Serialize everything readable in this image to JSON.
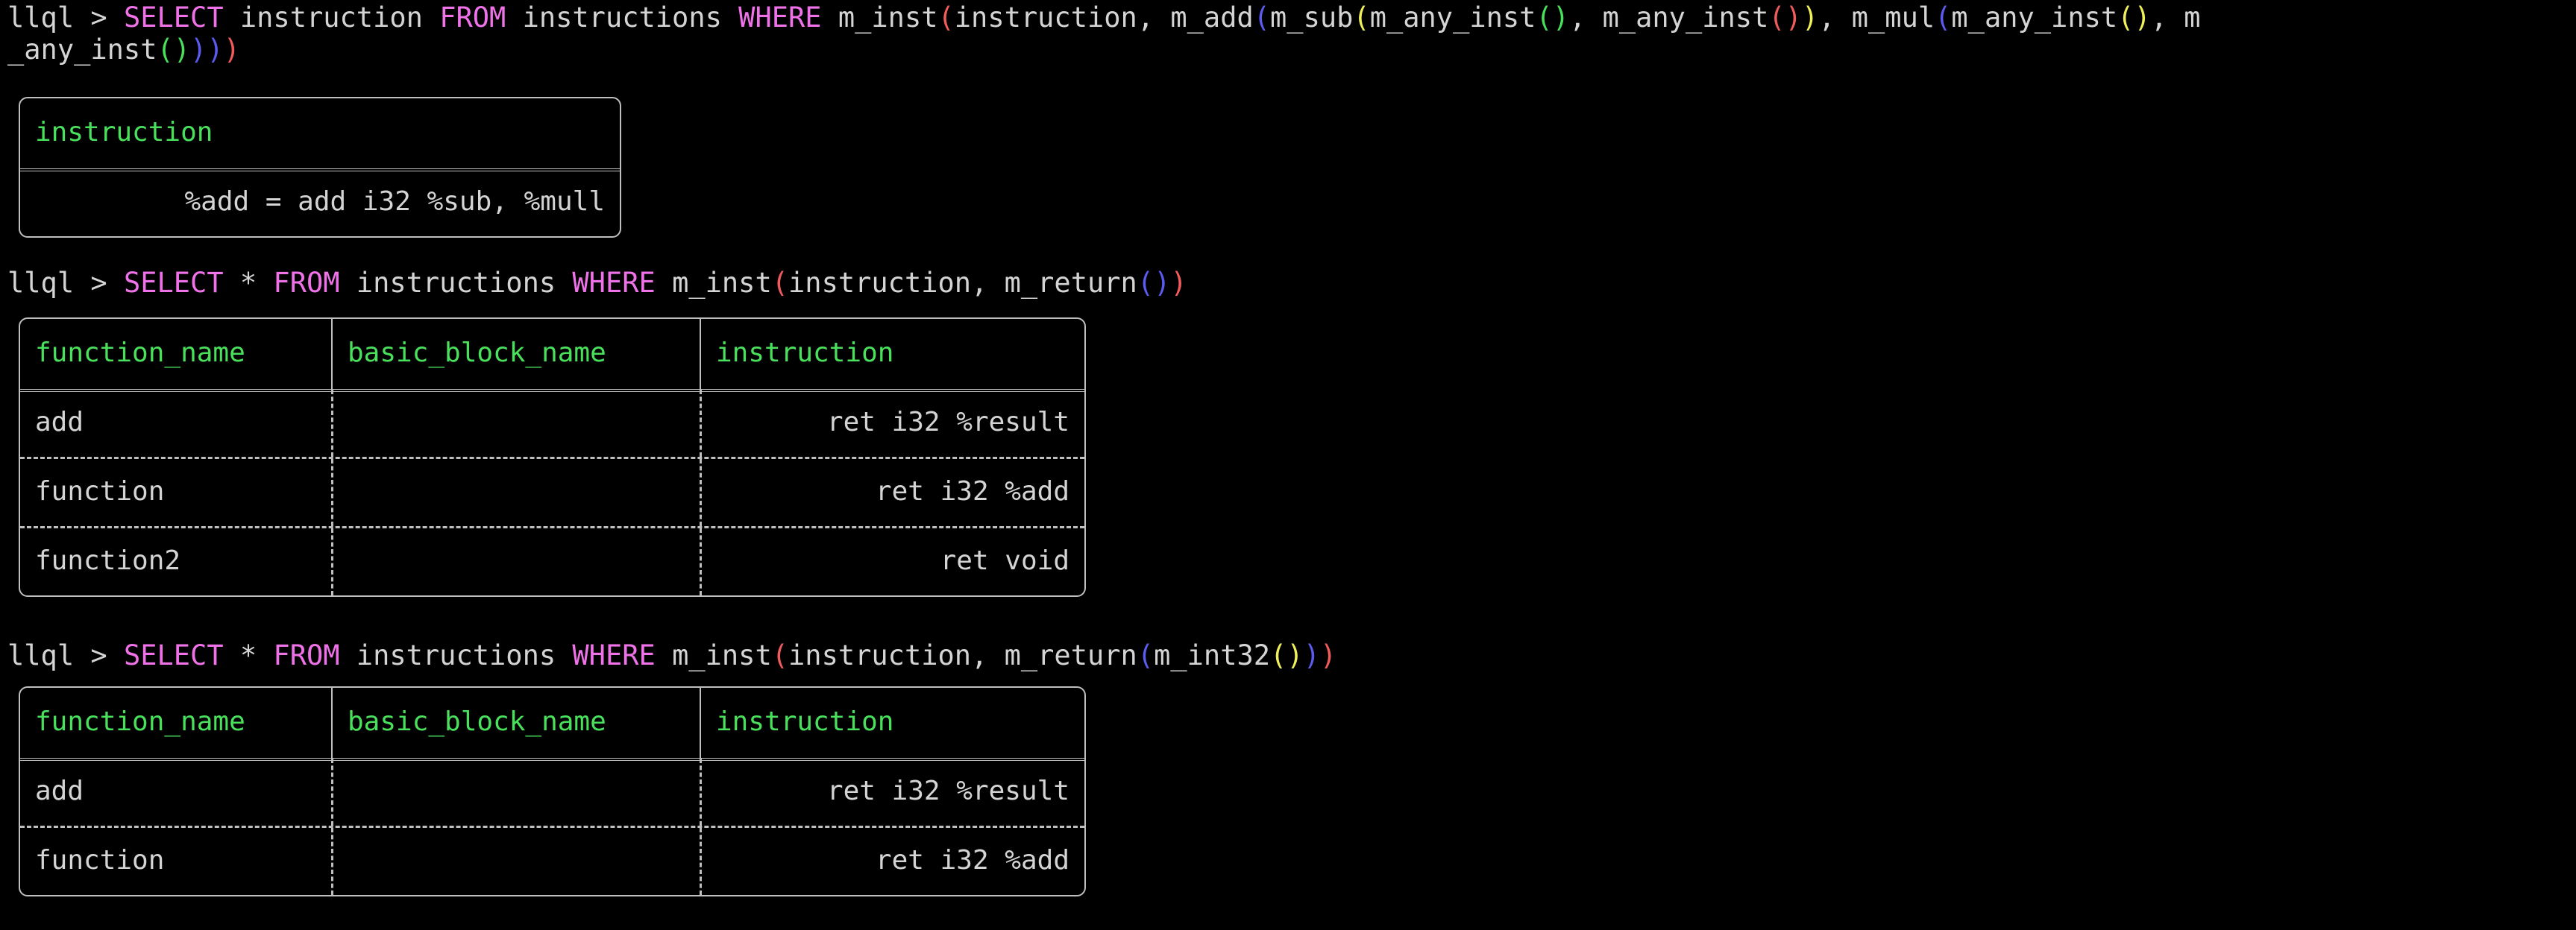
{
  "theme": {
    "background": "#000000",
    "foreground": "#d4d4d4",
    "keyword": "#ef72e8",
    "header_text": "#49e05b",
    "border": "#bfbfbf",
    "paren_level_1": "#f05b5b",
    "paren_level_2": "#5b5bf0",
    "paren_level_3": "#f0f05b",
    "paren_level_4": "#49e05b"
  },
  "prompt": {
    "label": "llql",
    "symbol": ">"
  },
  "blocks": [
    {
      "id": "block-1",
      "query": {
        "line1": "llql > SELECT instruction FROM instructions WHERE m_inst(instruction, m_add(m_sub(m_any_inst(), m_any_inst()), m_mul(m_any_inst(), m",
        "line2": "_any_inst())))",
        "full": "llql > SELECT instruction FROM instructions WHERE m_inst(instruction, m_add(m_sub(m_any_inst(), m_any_inst()), m_mul(m_any_inst(), m_any_inst())))",
        "keywords": [
          "SELECT",
          "FROM",
          "WHERE"
        ]
      },
      "table": {
        "columns": [
          "instruction"
        ],
        "aligns": [
          "right"
        ],
        "rows": [
          [
            "%add = add i32 %sub, %mull"
          ]
        ]
      }
    },
    {
      "id": "block-2",
      "query": {
        "line1": "llql > SELECT * FROM instructions WHERE m_inst(instruction, m_return())",
        "full": "llql > SELECT * FROM instructions WHERE m_inst(instruction, m_return())",
        "keywords": [
          "SELECT",
          "FROM",
          "WHERE"
        ]
      },
      "table": {
        "columns": [
          "function_name",
          "basic_block_name",
          "instruction"
        ],
        "aligns": [
          "left",
          "left",
          "right"
        ],
        "rows": [
          [
            "add",
            "",
            "ret i32 %result"
          ],
          [
            "function",
            "",
            "ret i32 %add"
          ],
          [
            "function2",
            "",
            "ret void"
          ]
        ]
      }
    },
    {
      "id": "block-3",
      "query": {
        "line1": "llql > SELECT * FROM instructions WHERE m_inst(instruction, m_return(m_int32()))",
        "full": "llql > SELECT * FROM instructions WHERE m_inst(instruction, m_return(m_int32()))",
        "keywords": [
          "SELECT",
          "FROM",
          "WHERE"
        ]
      },
      "table": {
        "columns": [
          "function_name",
          "basic_block_name",
          "instruction"
        ],
        "aligns": [
          "left",
          "left",
          "right"
        ],
        "rows": [
          [
            "add",
            "",
            "ret i32 %result"
          ],
          [
            "function",
            "",
            "ret i32 %add"
          ]
        ]
      }
    }
  ],
  "query1": {
    "seg_prompt": "llql > ",
    "seg_select": "SELECT",
    "seg_a": " instruction ",
    "seg_from": "FROM",
    "seg_b": " instructions ",
    "seg_where": "WHERE",
    "seg_c": " m_inst",
    "p1_open": "(",
    "seg_d": "instruction, m_add",
    "p2_open": "(",
    "seg_e": "m_sub",
    "p3_open": "(",
    "seg_f": "m_any_inst",
    "p4a": "()",
    "seg_g": ", m_any_inst",
    "p4b": "()",
    "p3_close": ")",
    "seg_h": ", m_mul",
    "p3b_open": "(",
    "seg_i": "m_any_inst",
    "p4c": "()",
    "seg_j": ", m",
    "line2_seg_a": "_any_inst",
    "line2_p4": "()",
    "line2_p3": ")",
    "line2_p2": ")",
    "line2_p1": ")"
  },
  "query2": {
    "seg_prompt": "llql > ",
    "seg_select": "SELECT",
    "seg_a": " * ",
    "seg_from": "FROM",
    "seg_b": " instructions ",
    "seg_where": "WHERE",
    "seg_c": " m_inst",
    "p1_open": "(",
    "seg_d": "instruction, m_return",
    "p2": "()",
    "p1_close": ")"
  },
  "query3": {
    "seg_prompt": "llql > ",
    "seg_select": "SELECT",
    "seg_a": " * ",
    "seg_from": "FROM",
    "seg_b": " instructions ",
    "seg_where": "WHERE",
    "seg_c": " m_inst",
    "p1_open": "(",
    "seg_d": "instruction, m_return",
    "p2_open": "(",
    "seg_e": "m_int32",
    "p3": "()",
    "p2_close": ")",
    "p1_close": ")"
  }
}
